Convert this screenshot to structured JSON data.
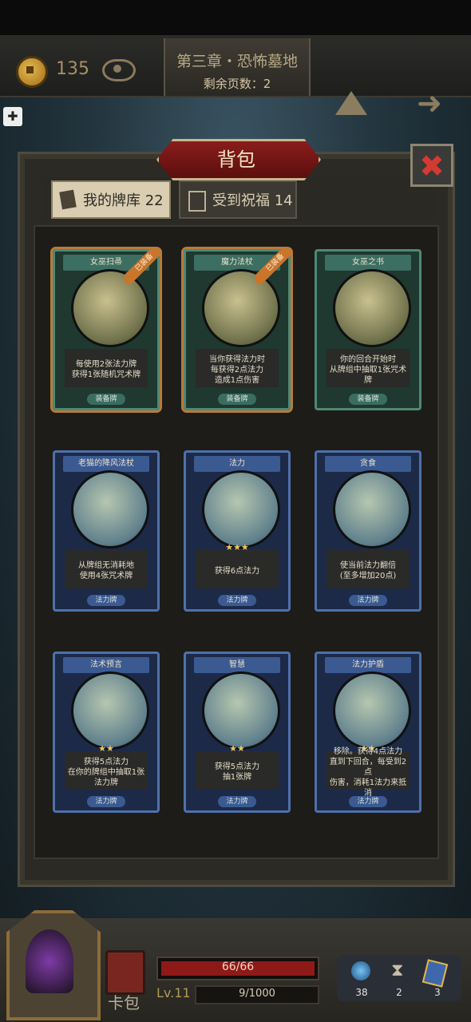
{
  "hud": {
    "coins": "135",
    "chapter": "第三章・恐怖墓地",
    "pages_remaining": "剩余页数：2"
  },
  "panel": {
    "title": "背包",
    "tabs": [
      {
        "label": "我的牌库 22",
        "icon": "cards-icon",
        "selected": true
      },
      {
        "label": "受到祝福 14",
        "icon": "gift-icon",
        "selected": false
      }
    ]
  },
  "cards": [
    {
      "name": "女巫扫帚",
      "desc": "每使用2张法力牌\n获得1张随机咒术牌",
      "type": "装备牌",
      "stars": "",
      "equipped": true,
      "badge": "已装备",
      "theme": "green"
    },
    {
      "name": "魔力法杖",
      "desc": "当你获得法力时\n每获得2点法力\n造成1点伤害",
      "type": "装备牌",
      "stars": "",
      "equipped": true,
      "badge": "已装备",
      "theme": "green"
    },
    {
      "name": "女巫之书",
      "desc": "你的回合开始时\n从牌组中抽取1张咒术牌",
      "type": "装备牌",
      "stars": "",
      "equipped": false,
      "badge": "",
      "theme": "green"
    },
    {
      "name": "老猫的降风法杖",
      "desc": "从牌组无消耗地\n使用4张咒术牌",
      "type": "法力牌",
      "stars": "",
      "equipped": false,
      "badge": "",
      "theme": "blue"
    },
    {
      "name": "法力",
      "desc": "获得6点法力",
      "type": "法力牌",
      "stars": "★★★",
      "equipped": false,
      "badge": "",
      "theme": "blue"
    },
    {
      "name": "贪食",
      "desc": "使当前法力翻倍\n(至多增加20点)",
      "type": "法力牌",
      "stars": "",
      "equipped": false,
      "badge": "",
      "theme": "blue"
    },
    {
      "name": "法术预言",
      "desc": "获得5点法力\n在你的牌组中抽取1张\n法力牌",
      "type": "法力牌",
      "stars": "★★",
      "equipped": false,
      "badge": "",
      "theme": "blue"
    },
    {
      "name": "智慧",
      "desc": "获得5点法力\n抽1张牌",
      "type": "法力牌",
      "stars": "★★",
      "equipped": false,
      "badge": "",
      "theme": "blue"
    },
    {
      "name": "法力护盾",
      "desc": "移除。获得4点法力\n直到下回合，每受到2点\n伤害，消耗1法力来抵消",
      "type": "法力牌",
      "stars": "★★",
      "equipped": false,
      "badge": "",
      "theme": "blue"
    }
  ],
  "player": {
    "hp": "66/66",
    "hp_fraction": 1.0,
    "level": "Lv.11",
    "xp": "9/1000",
    "bag_label": "卡包"
  },
  "stats": [
    {
      "icon": "mana-orb-icon",
      "value": "38"
    },
    {
      "icon": "hourglass-icon",
      "value": "2"
    },
    {
      "icon": "card-stack-icon",
      "value": "3"
    }
  ]
}
